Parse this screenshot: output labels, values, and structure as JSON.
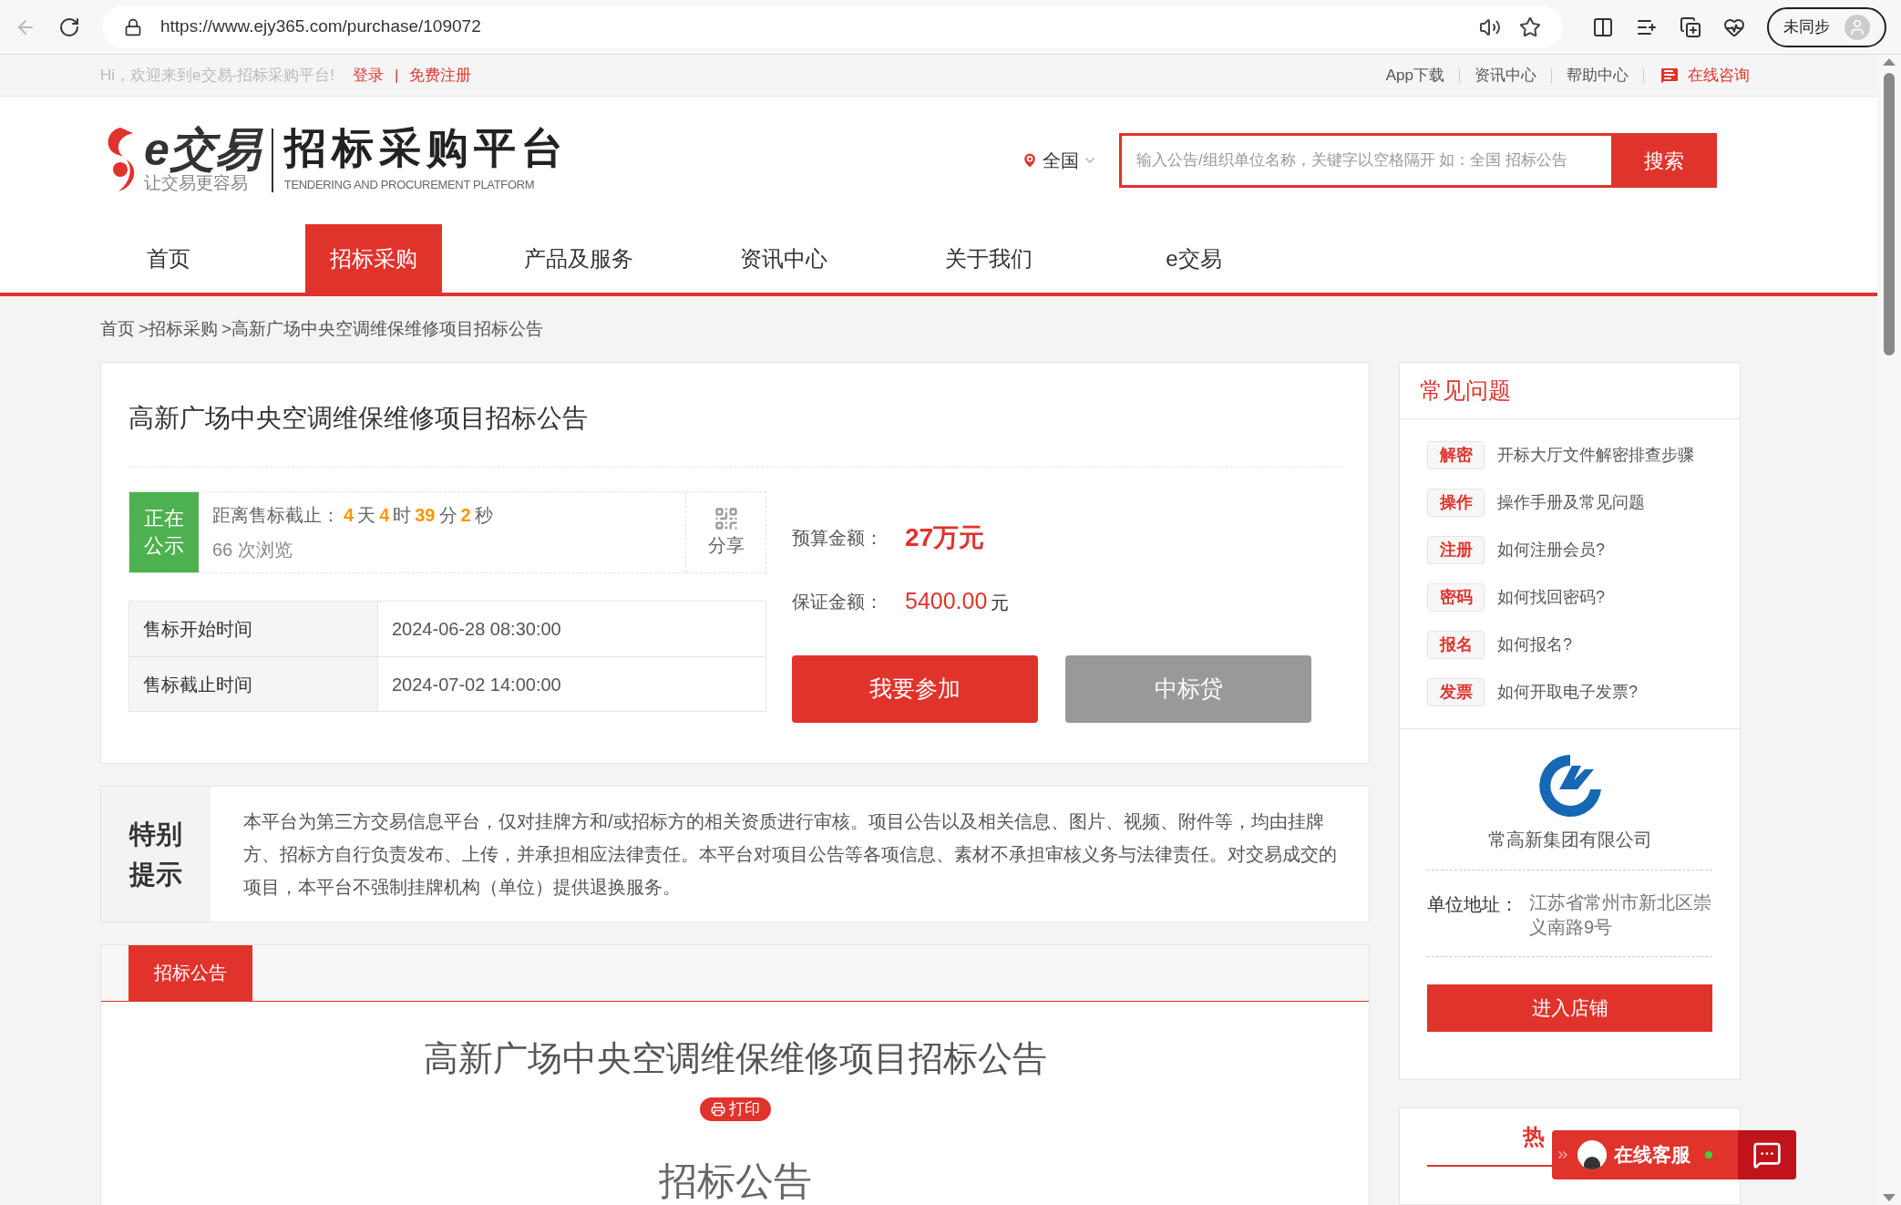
{
  "browser": {
    "url": "https://www.ejy365.com/purchase/109072",
    "profile": "未同步"
  },
  "top_bar": {
    "greeting": "Hi，欢迎来到e交易-招标采购平台!",
    "login": "登录",
    "separator": "|",
    "register": "免费注册",
    "links": [
      "App下载",
      "资讯中心",
      "帮助中心"
    ],
    "consult": "在线咨询"
  },
  "logo": {
    "brand": "e交易",
    "slogan": "让交易更容易",
    "platform": "招标采购平台",
    "platform_en": "TENDERING AND PROCUREMENT PLATFORM"
  },
  "search": {
    "region": "全国",
    "placeholder": "输入公告/组织单位名称，关键字以空格隔开 如：全国 招标公告",
    "button": "搜索"
  },
  "nav": [
    {
      "label": "首页",
      "selected": false
    },
    {
      "label": "招标采购",
      "selected": true
    },
    {
      "label": "产品及服务",
      "selected": false
    },
    {
      "label": "资讯中心",
      "selected": false
    },
    {
      "label": "关于我们",
      "selected": false
    },
    {
      "label": "e交易",
      "selected": false
    }
  ],
  "breadcrumb": [
    "首页",
    ">招标采购",
    ">高新广场中央空调维保维修项目招标公告"
  ],
  "project": {
    "title": "高新广场中央空调维保维修项目招标公告",
    "status": "正在公示",
    "countdown_label": "距离售标截止：",
    "countdown": [
      {
        "value": "4",
        "unit": "天"
      },
      {
        "value": "4",
        "unit": "时"
      },
      {
        "value": "39",
        "unit": "分"
      },
      {
        "value": "2",
        "unit": "秒"
      }
    ],
    "views": "66 次浏览",
    "share": "分享",
    "times": [
      {
        "label": "售标开始时间",
        "value": "2024-06-28 08:30:00"
      },
      {
        "label": "售标截止时间",
        "value": "2024-07-02 14:00:00"
      }
    ],
    "budget_label": "预算金额：",
    "budget": "27万元",
    "deposit_label": "保证金额：",
    "deposit": "5400.00",
    "deposit_unit": "元",
    "join_button": "我要参加",
    "loan_button": "中标贷"
  },
  "notice": {
    "title": "特别提示",
    "text": "本平台为第三方交易信息平台，仅对挂牌方和/或招标方的相关资质进行审核。项目公告以及相关信息、图片、视频、附件等，均由挂牌方、招标方自行负责发布、上传，并承担相应法律责任。本平台对项目公告等各项信息、素材不承担审核义务与法律责任。对交易成交的项目，本平台不强制挂牌机构（单位）提供退换服务。"
  },
  "announcement": {
    "tab": "招标公告",
    "title": "高新广场中央空调维保维修项目招标公告",
    "print": "打印",
    "heading": "招标公告"
  },
  "faq": {
    "title": "常见问题",
    "items": [
      {
        "tag": "解密",
        "text": "开标大厅文件解密排查步骤"
      },
      {
        "tag": "操作",
        "text": "操作手册及常见问题"
      },
      {
        "tag": "注册",
        "text": "如何注册会员?"
      },
      {
        "tag": "密码",
        "text": "如何找回密码?"
      },
      {
        "tag": "报名",
        "text": "如何报名?"
      },
      {
        "tag": "发票",
        "text": "如何开取电子发票?"
      }
    ]
  },
  "company": {
    "name": "常高新集团有限公司",
    "address_label": "单位地址：",
    "address": "江苏省常州市新北区崇义南路9号",
    "button": "进入店铺"
  },
  "hot": {
    "title": "热"
  },
  "chat": {
    "label": "在线客服"
  }
}
